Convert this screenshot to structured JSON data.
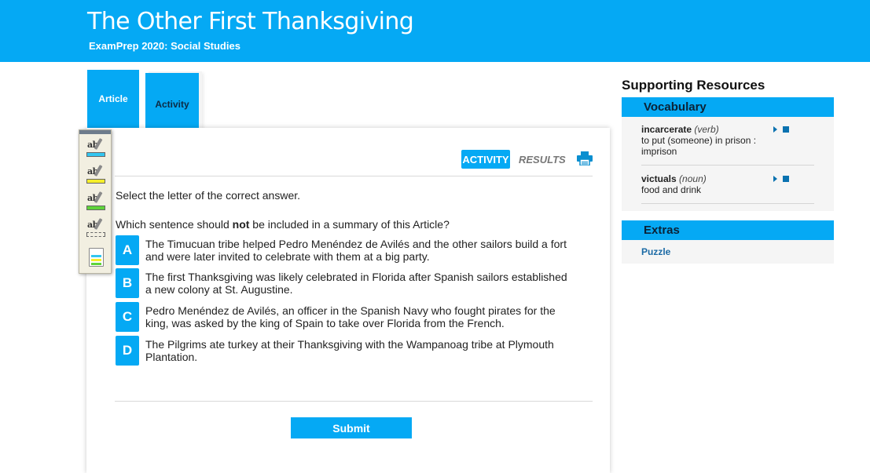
{
  "header": {
    "title": "The Other First Thanksgiving",
    "subtitle": "ExamPrep 2020: Social Studies"
  },
  "tabs": {
    "article": "Article",
    "activity": "Activity"
  },
  "panel_tabs": {
    "activity": "ACTIVITY",
    "results": "RESULTS"
  },
  "instructions": "Select the letter of the correct answer.",
  "question": {
    "before": "Which sentence should ",
    "emphasis": "not",
    "after": " be included in a summary of this Article?"
  },
  "options": [
    {
      "letter": "A",
      "text": "The Timucuan tribe helped Pedro Menéndez de Avilés and the other sailors build a fort and were later invited to celebrate with them at a big party."
    },
    {
      "letter": "B",
      "text": "The first Thanksgiving was likely celebrated in Florida after Spanish sailors established a new colony at St. Augustine."
    },
    {
      "letter": "C",
      "text": "Pedro Menéndez de Avilés, an officer in the Spanish Navy who fought pirates for the king, was asked by the king of Spain to take over Florida from the French."
    },
    {
      "letter": "D",
      "text": "The Pilgrims ate turkey at their Thanksgiving with the Wampanoag tribe at Plymouth Plantation."
    }
  ],
  "submit_label": "Submit",
  "highlighter_tools": {
    "glyph": "ab",
    "colors": [
      "#33c6f0",
      "#f5ee2b",
      "#5fd43a"
    ]
  },
  "sidebar": {
    "title": "Supporting Resources",
    "vocabulary_heading": "Vocabulary",
    "vocabulary": [
      {
        "word": "incarcerate",
        "pos": "(verb)",
        "definition": "to put (someone) in prison : imprison"
      },
      {
        "word": "victuals",
        "pos": "(noun)",
        "definition": "food and drink"
      }
    ],
    "extras_heading": "Extras",
    "extras": [
      {
        "label": "Puzzle"
      }
    ]
  },
  "colors": {
    "accent": "#05a9f4",
    "link": "#1b6aa5"
  }
}
